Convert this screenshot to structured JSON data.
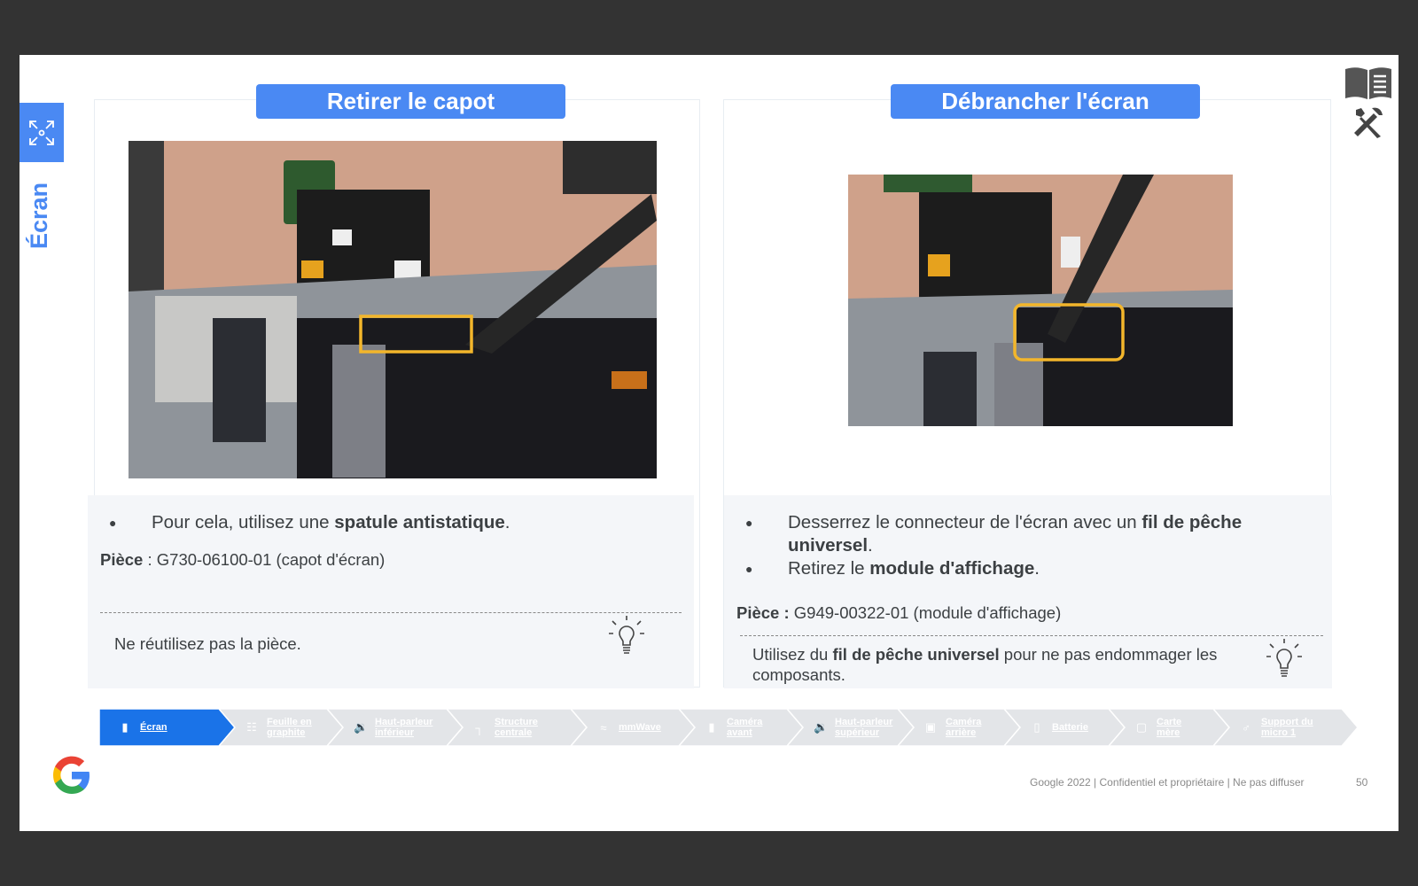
{
  "sidebar": {
    "title": "Écran"
  },
  "left_panel": {
    "title": "Retirer le capot",
    "bullets": [
      {
        "text": "Pour cela, utilisez une ",
        "bold": "spatule antistatique",
        "after": "."
      }
    ],
    "part_label": "Pièce",
    "part_value": " : G730-06100-01 (capot d'écran)",
    "tip": "Ne réutilisez pas la pièce."
  },
  "right_panel": {
    "title": "Débrancher l'écran",
    "bullets": [
      {
        "text": "Desserrez le connecteur de l'écran avec un ",
        "bold": "fil de pêche universel",
        "after": "."
      },
      {
        "text": "Retirez le ",
        "bold": "module d'affichage",
        "after": "."
      }
    ],
    "part_label": "Pièce :",
    "part_value": " G949-00322-01 (module d'affichage)",
    "tip_before": "Utilisez du ",
    "tip_bold": "fil de pêche universel",
    "tip_after": " pour ne pas endommager les composants."
  },
  "nav": {
    "active_color": "#1a73e8",
    "inactive_color": "#e3e5e8",
    "steps": [
      {
        "label": "Écran",
        "icon": "phone-icon",
        "active": true
      },
      {
        "label": "Feuille en\ngraphite",
        "icon": "grid-icon",
        "active": false
      },
      {
        "label": "Haut-parleur\ninférieur",
        "icon": "speaker-icon",
        "active": false
      },
      {
        "label": "Structure\ncentrale",
        "icon": "frame-icon",
        "active": false
      },
      {
        "label": "mmWave",
        "icon": "wifi-icon",
        "active": false
      },
      {
        "label": "Caméra\navant",
        "icon": "phone-icon",
        "active": false
      },
      {
        "label": "Haut-parleur\nsupérieur",
        "icon": "speaker-icon",
        "active": false
      },
      {
        "label": "Caméra\narrière",
        "icon": "camera-icon",
        "active": false
      },
      {
        "label": "Batterie",
        "icon": "battery-icon",
        "active": false
      },
      {
        "label": "Carte\nmère",
        "icon": "chip-icon",
        "active": false
      },
      {
        "label": "Support du\nmicro 1",
        "icon": "mic-icon",
        "active": false
      }
    ]
  },
  "footer": {
    "text": "Google 2022 | Confidentiel et propriétaire | Ne pas diffuser",
    "page": "50"
  },
  "colors": {
    "accent": "#4a89f3",
    "highlight": "#f3b62b"
  }
}
